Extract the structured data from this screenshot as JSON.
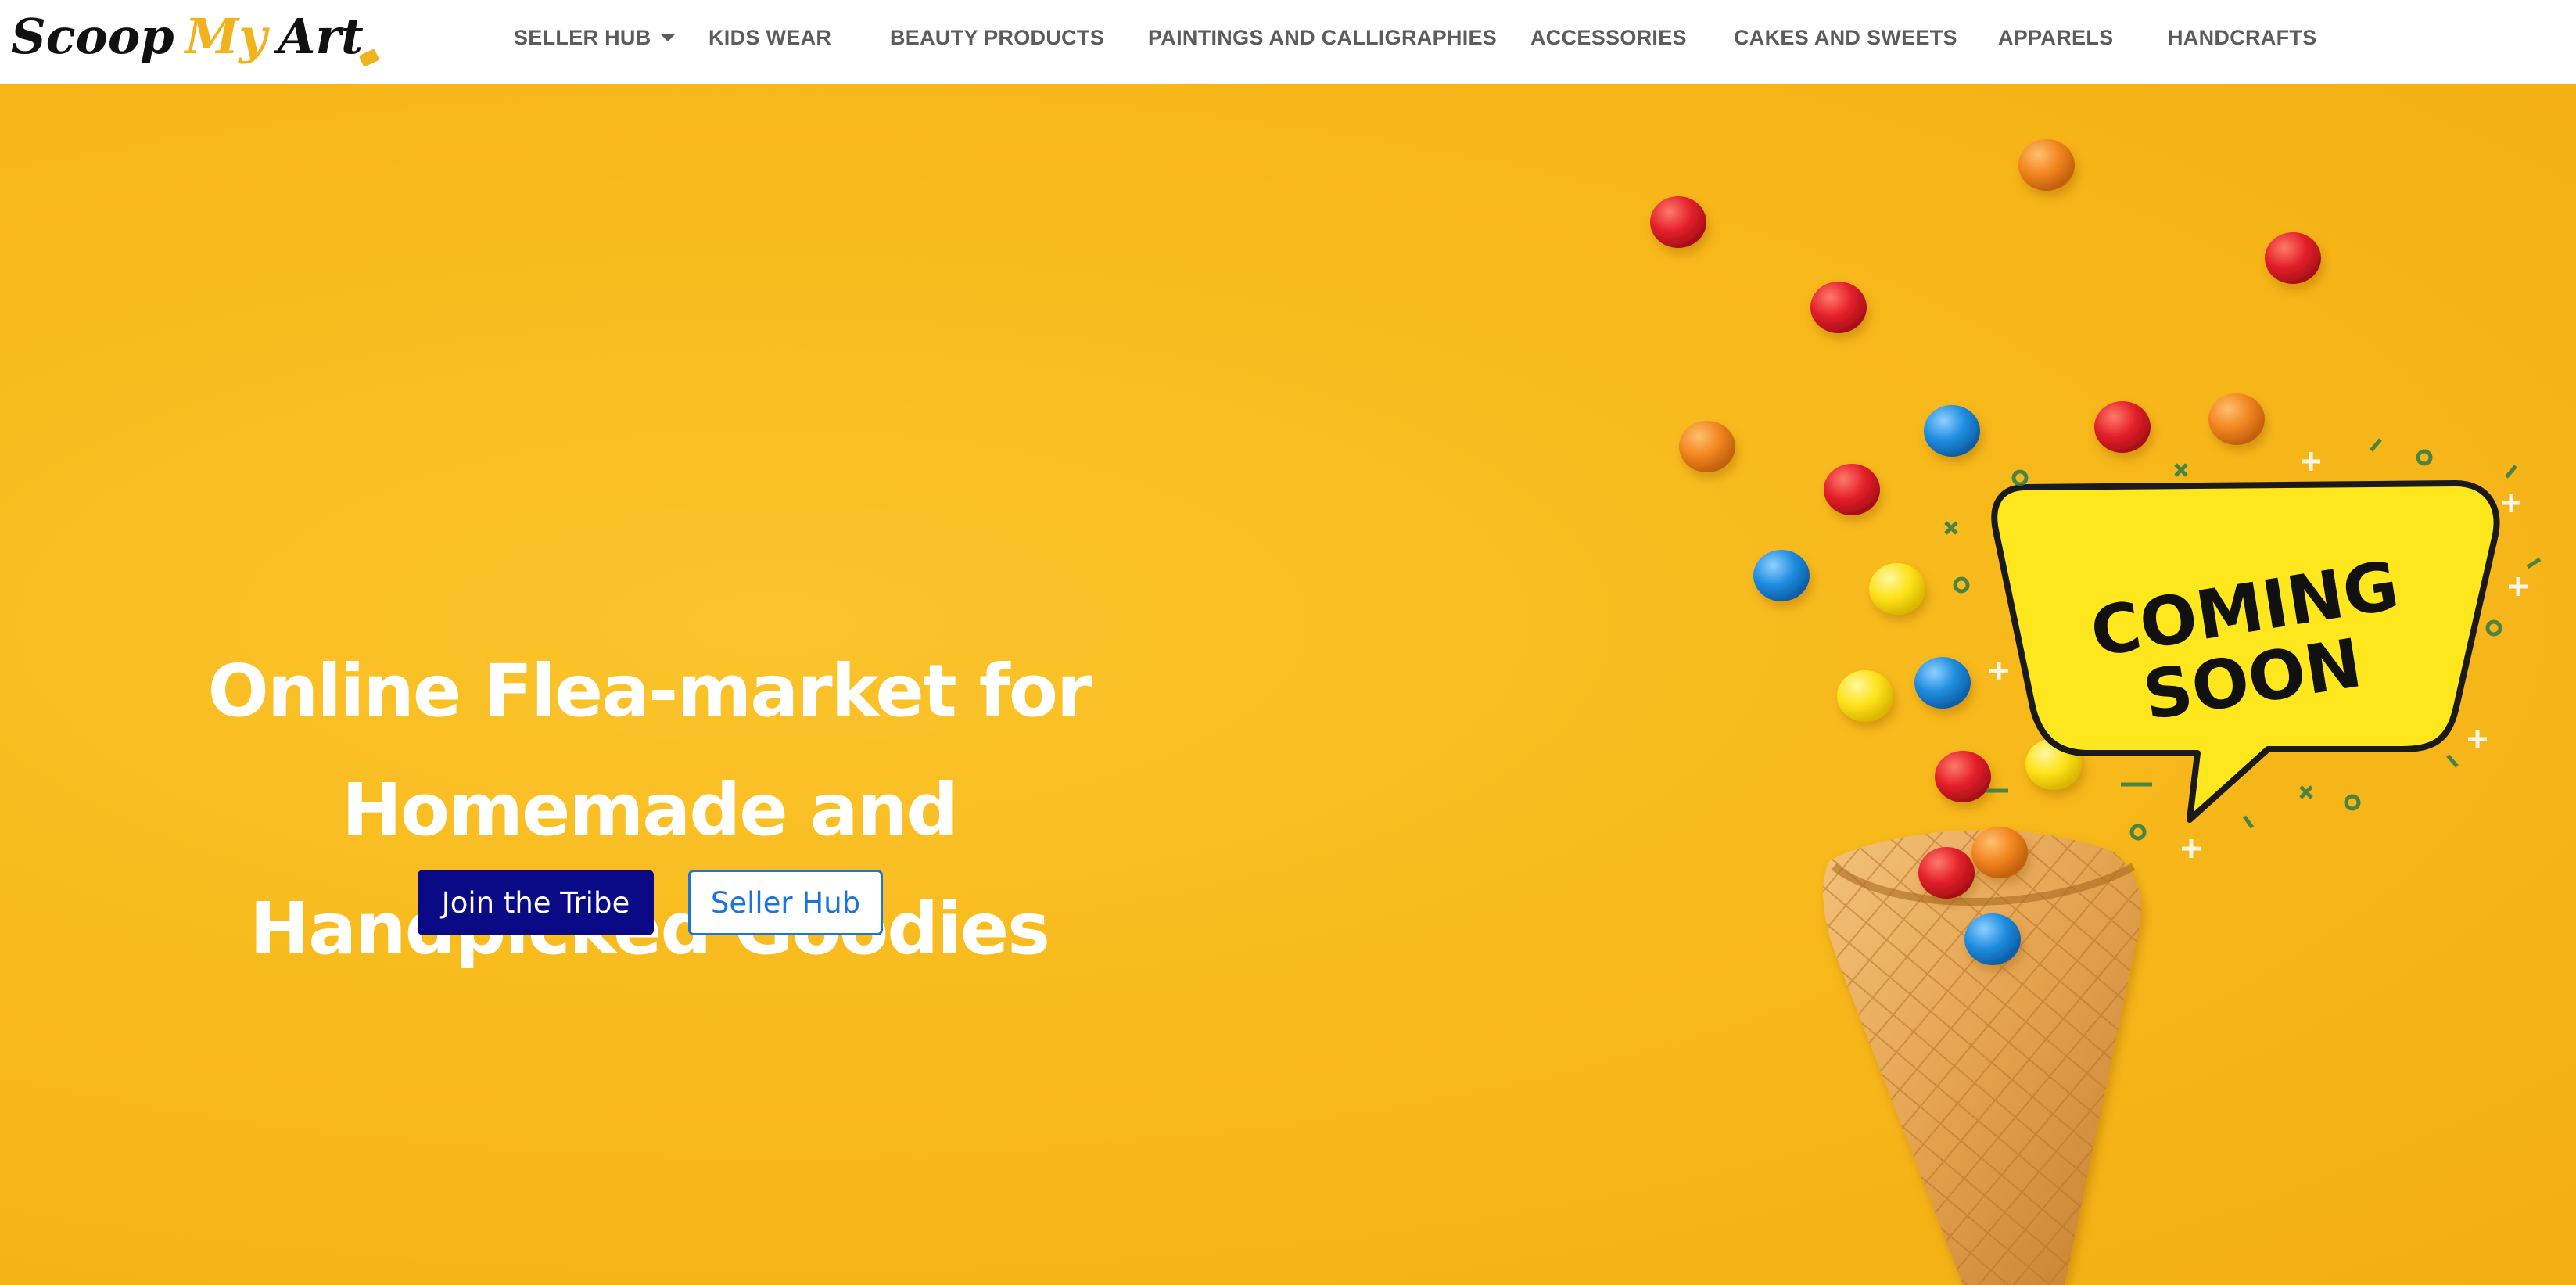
{
  "brand": {
    "logo_part1": "Scoop",
    "logo_part2": "My",
    "logo_part3": "Art"
  },
  "nav": {
    "items": [
      {
        "label": "SELLER HUB",
        "has_dropdown": true
      },
      {
        "label": "KIDS WEAR"
      },
      {
        "label": "BEAUTY PRODUCTS"
      },
      {
        "label": "PAINTINGS AND CALLIGRAPHIES"
      },
      {
        "label": "ACCESSORIES"
      },
      {
        "label": "CAKES AND SWEETS"
      },
      {
        "label": "APPARELS"
      },
      {
        "label": "HANDCRAFTS"
      }
    ]
  },
  "hero": {
    "title_line1": "Online Flea-market for Homemade and",
    "title_line2": "Handpicked Goodies",
    "primary_button": "Join the Tribe",
    "secondary_button": "Seller Hub",
    "badge_line1": "COMING",
    "badge_line2": "SOON"
  },
  "colors": {
    "hero_background": "#f8ba1c",
    "primary_button": "#0a0a86",
    "outline_button": "#1d74d8",
    "logo_accent": "#f2b21c",
    "nav_text": "#5c5c5c"
  },
  "icons": {
    "dropdown": "chevron-down-icon",
    "decoration": "ice-cream-cone-with-candies"
  }
}
